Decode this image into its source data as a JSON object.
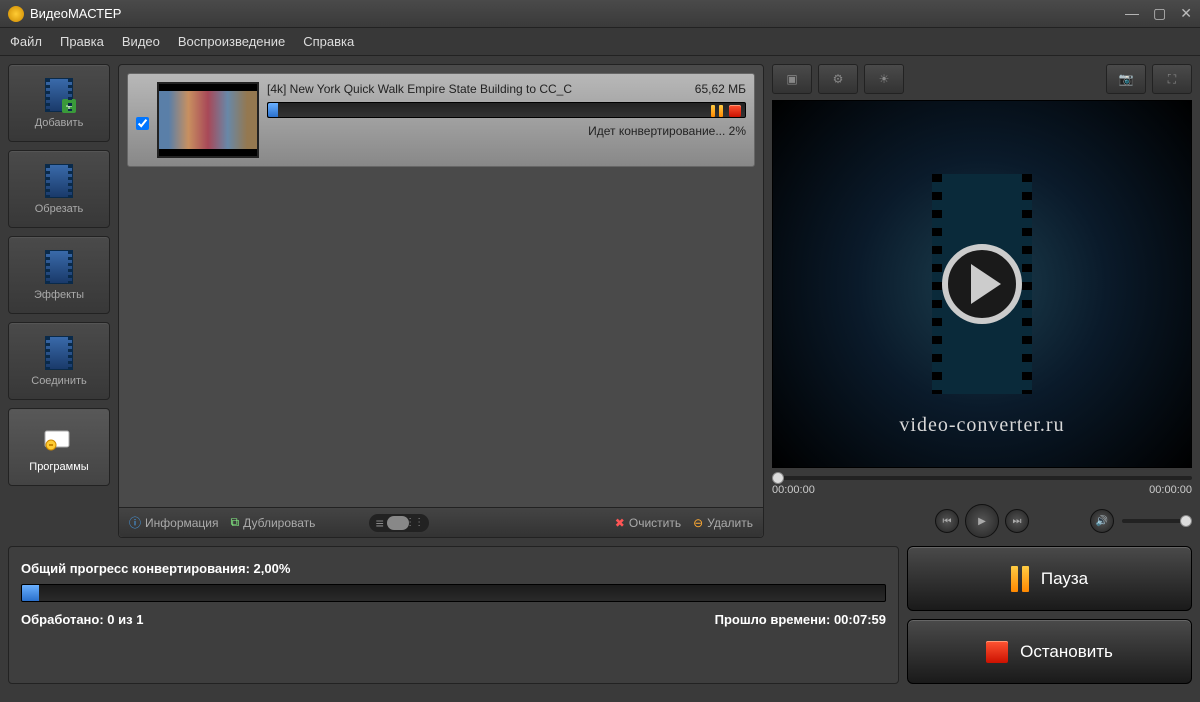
{
  "app": {
    "title": "ВидеоМАСТЕР"
  },
  "menu": {
    "file": "Файл",
    "edit": "Правка",
    "video": "Видео",
    "playback": "Воспроизведение",
    "help": "Справка"
  },
  "sidebar": {
    "add": "Добавить",
    "trim": "Обрезать",
    "effects": "Эффекты",
    "join": "Соединить",
    "programs": "Программы"
  },
  "file": {
    "name": "[4k] New York Quick Walk Empire State Building to CC_C",
    "size": "65,62 МБ",
    "status": "Идет конвертирование... 2%",
    "progress_pct": 2
  },
  "center_toolbar": {
    "info": "Информация",
    "duplicate": "Дублировать",
    "clear": "Очистить",
    "delete": "Удалить"
  },
  "preview": {
    "brand": "video-converter.ru",
    "time_start": "00:00:00",
    "time_end": "00:00:00"
  },
  "progress": {
    "label_prefix": "Общий прогресс конвертирования: ",
    "pct_text": "2,00%",
    "processed_label": "Обработано: ",
    "processed_value": "0 из 1",
    "elapsed_label": "Прошло времени: ",
    "elapsed_value": "00:07:59"
  },
  "actions": {
    "pause": "Пауза",
    "stop": "Остановить"
  }
}
